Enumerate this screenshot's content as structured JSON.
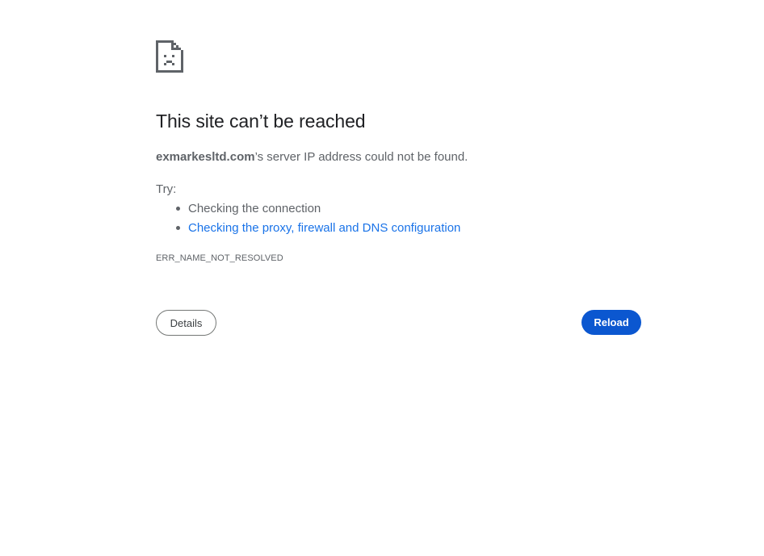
{
  "page": {
    "icon": "sad-document-icon",
    "title": "This site can’t be reached",
    "summary_host": "exmarkesltd.com",
    "summary_rest": "’s server IP address could not be found.",
    "try_label": "Try:",
    "suggestions": [
      {
        "text": "Checking the connection",
        "link": false
      },
      {
        "text": "Checking the proxy, firewall and DNS configuration",
        "link": true
      }
    ],
    "error_code": "ERR_NAME_NOT_RESOLVED"
  },
  "buttons": {
    "details_label": "Details",
    "reload_label": "Reload"
  },
  "colors": {
    "text": "#202124",
    "secondary_text": "#5f6368",
    "link": "#1a73e8",
    "reload_bg": "#0b57d0",
    "reload_text": "#ffffff"
  }
}
